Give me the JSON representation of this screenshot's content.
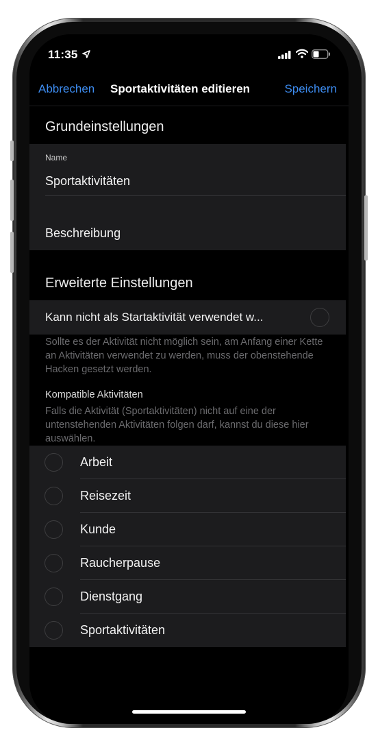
{
  "status_bar": {
    "time": "11:35",
    "location_icon": "location-arrow-icon",
    "signal_icon": "cellular-signal-icon",
    "wifi_icon": "wifi-icon",
    "battery_icon": "battery-icon"
  },
  "nav": {
    "cancel_label": "Abbrechen",
    "title": "Sportaktivitäten editieren",
    "save_label": "Speichern",
    "accent_color": "#3d8cf0"
  },
  "basic_settings": {
    "header": "Grundeinstellungen",
    "name_label": "Name",
    "name_value": "Sportaktivitäten",
    "description_placeholder": "Beschreibung"
  },
  "advanced_settings": {
    "header": "Erweiterte Einstellungen",
    "toggle_label": "Kann nicht als Startaktivität verwendet w...",
    "toggle_footnote": "Sollte es der Aktivität nicht möglich sein, am Anfang einer Kette an Aktivitäten verwendet zu werden, muss der obenstehende Hacken gesetzt werden.",
    "compatible_header": "Kompatible Aktivitäten",
    "compatible_footnote": "Falls die Aktivität (Sportaktivitäten) nicht auf eine der untenstehenden Aktivitäten folgen darf, kannst du diese hier auswählen.",
    "activities": [
      {
        "label": "Arbeit"
      },
      {
        "label": "Reisezeit"
      },
      {
        "label": "Kunde"
      },
      {
        "label": "Raucherpause"
      },
      {
        "label": "Dienstgang"
      },
      {
        "label": "Sportaktivitäten"
      }
    ]
  }
}
